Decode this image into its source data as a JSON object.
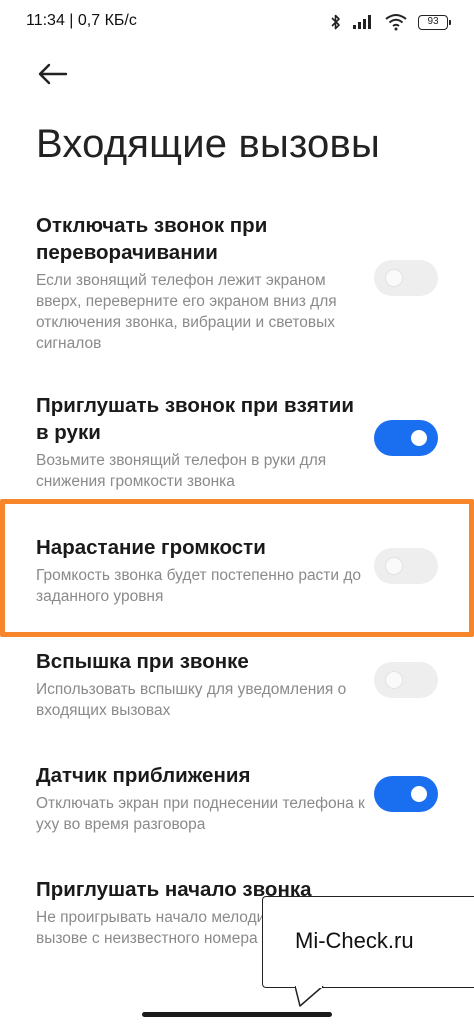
{
  "status_bar": {
    "time": "11:34 | 0,7 КБ/с",
    "battery": "93"
  },
  "header": {
    "title": "Входящие вызовы"
  },
  "settings": [
    {
      "title": "Отключать звонок при переворачивании",
      "description": "Если звонящий телефон лежит экраном вверх, переверните его экраном вниз для отключения звонка, вибрации и световых сигналов",
      "enabled": false
    },
    {
      "title": "Приглушать звонок при взятии в руки",
      "description": "Возьмите звонящий телефон в руки для снижения громкости звонка",
      "enabled": true
    },
    {
      "title": "Нарастание громкости",
      "description": "Громкость звонка будет постепенно расти до заданного уровня",
      "enabled": false
    },
    {
      "title": "Вспышка при звонке",
      "description": "Использовать вспышку для уведомления о входящих вызовах",
      "enabled": false
    },
    {
      "title": "Датчик приближения",
      "description": "Отключать экран при поднесении телефона к уху во время разговора",
      "enabled": true
    },
    {
      "title": "Приглушать начало звонка",
      "description": "Не проигрывать начало мелодии звонка при вызове с неизвестного номера",
      "enabled": null
    }
  ],
  "watermark": {
    "text": "Mi-Check.ru"
  },
  "colors": {
    "accent": "#1a6ff0",
    "highlight": "#f7862b",
    "toggle_off": "#eeeeee",
    "description_text": "#8a8a8a"
  }
}
